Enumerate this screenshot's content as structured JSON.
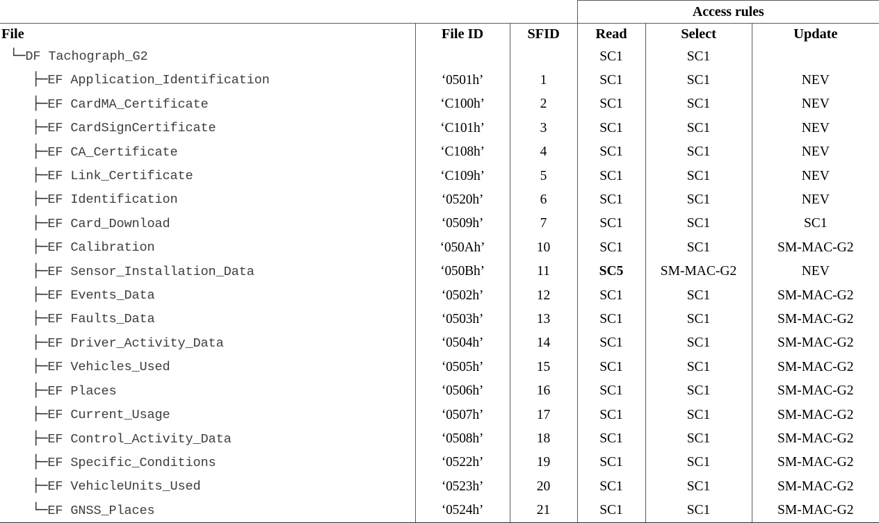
{
  "document": {
    "title": "Tachograph card file structure access rules table"
  },
  "table": {
    "super_header": {
      "access_rules_label": "Access rules"
    },
    "headers": {
      "file": "File",
      "file_id": "File ID",
      "sfid": "SFID",
      "read": "Read",
      "select": "Select",
      "update": "Update"
    },
    "rows": [
      {
        "tree": "└─",
        "indent": 1,
        "name": "DF Tachograph_G2",
        "file_id": "",
        "sfid": "",
        "read": "SC1",
        "select": "SC1",
        "update": "",
        "read_bold": false
      },
      {
        "tree": "├─",
        "indent": 2,
        "name": "EF Application_Identification",
        "file_id": "‘0501h’",
        "sfid": "1",
        "read": "SC1",
        "select": "SC1",
        "update": "NEV",
        "read_bold": false
      },
      {
        "tree": "├─",
        "indent": 2,
        "name": "EF CardMA_Certificate",
        "file_id": "‘C100h’",
        "sfid": "2",
        "read": "SC1",
        "select": "SC1",
        "update": "NEV",
        "read_bold": false
      },
      {
        "tree": "├─",
        "indent": 2,
        "name": "EF CardSignCertificate",
        "file_id": "‘C101h’",
        "sfid": "3",
        "read": "SC1",
        "select": "SC1",
        "update": "NEV",
        "read_bold": false
      },
      {
        "tree": "├─",
        "indent": 2,
        "name": "EF CA_Certificate",
        "file_id": "‘C108h’",
        "sfid": "4",
        "read": "SC1",
        "select": "SC1",
        "update": "NEV",
        "read_bold": false
      },
      {
        "tree": "├─",
        "indent": 2,
        "name": "EF Link_Certificate",
        "file_id": "‘C109h’",
        "sfid": "5",
        "read": "SC1",
        "select": "SC1",
        "update": "NEV",
        "read_bold": false
      },
      {
        "tree": "├─",
        "indent": 2,
        "name": "EF Identification",
        "file_id": "‘0520h’",
        "sfid": "6",
        "read": "SC1",
        "select": "SC1",
        "update": "NEV",
        "read_bold": false
      },
      {
        "tree": "├─",
        "indent": 2,
        "name": "EF Card_Download",
        "file_id": "‘0509h’",
        "sfid": "7",
        "read": "SC1",
        "select": "SC1",
        "update": "SC1",
        "read_bold": false
      },
      {
        "tree": "├─",
        "indent": 2,
        "name": "EF Calibration",
        "file_id": "‘050Ah’",
        "sfid": "10",
        "read": "SC1",
        "select": "SC1",
        "update": "SM-MAC-G2",
        "read_bold": false
      },
      {
        "tree": "├─",
        "indent": 2,
        "name": "EF Sensor_Installation_Data",
        "file_id": "‘050Bh’",
        "sfid": "11",
        "read": "SC5",
        "select": "SM-MAC-G2",
        "update": "NEV",
        "read_bold": true
      },
      {
        "tree": "├─",
        "indent": 2,
        "name": "EF Events_Data",
        "file_id": "‘0502h’",
        "sfid": "12",
        "read": "SC1",
        "select": "SC1",
        "update": "SM-MAC-G2",
        "read_bold": false
      },
      {
        "tree": "├─",
        "indent": 2,
        "name": "EF Faults_Data",
        "file_id": "‘0503h’",
        "sfid": "13",
        "read": "SC1",
        "select": "SC1",
        "update": "SM-MAC-G2",
        "read_bold": false
      },
      {
        "tree": "├─",
        "indent": 2,
        "name": "EF Driver_Activity_Data",
        "file_id": "‘0504h’",
        "sfid": "14",
        "read": "SC1",
        "select": "SC1",
        "update": "SM-MAC-G2",
        "read_bold": false
      },
      {
        "tree": "├─",
        "indent": 2,
        "name": "EF Vehicles_Used",
        "file_id": "‘0505h’",
        "sfid": "15",
        "read": "SC1",
        "select": "SC1",
        "update": "SM-MAC-G2",
        "read_bold": false
      },
      {
        "tree": "├─",
        "indent": 2,
        "name": "EF Places",
        "file_id": "‘0506h’",
        "sfid": "16",
        "read": "SC1",
        "select": "SC1",
        "update": "SM-MAC-G2",
        "read_bold": false
      },
      {
        "tree": "├─",
        "indent": 2,
        "name": "EF Current_Usage",
        "file_id": "‘0507h’",
        "sfid": "17",
        "read": "SC1",
        "select": "SC1",
        "update": "SM-MAC-G2",
        "read_bold": false
      },
      {
        "tree": "├─",
        "indent": 2,
        "name": "EF Control_Activity_Data",
        "file_id": "‘0508h’",
        "sfid": "18",
        "read": "SC1",
        "select": "SC1",
        "update": "SM-MAC-G2",
        "read_bold": false
      },
      {
        "tree": "├─",
        "indent": 2,
        "name": "EF Specific_Conditions",
        "file_id": "‘0522h’",
        "sfid": "19",
        "read": "SC1",
        "select": "SC1",
        "update": "SM-MAC-G2",
        "read_bold": false
      },
      {
        "tree": "├─",
        "indent": 2,
        "name": "EF VehicleUnits_Used",
        "file_id": "‘0523h’",
        "sfid": "20",
        "read": "SC1",
        "select": "SC1",
        "update": "SM-MAC-G2",
        "read_bold": false
      },
      {
        "tree": "└─",
        "indent": 2,
        "name": "EF GNSS_Places",
        "file_id": "‘0524h’",
        "sfid": "21",
        "read": "SC1",
        "select": "SC1",
        "update": "SM-MAC-G2",
        "read_bold": false
      }
    ]
  },
  "colors": {
    "rule": "#555a5e",
    "bottom_rule": "#2c2c2c",
    "text": "#000000",
    "mono_text": "#3d3d3d"
  }
}
